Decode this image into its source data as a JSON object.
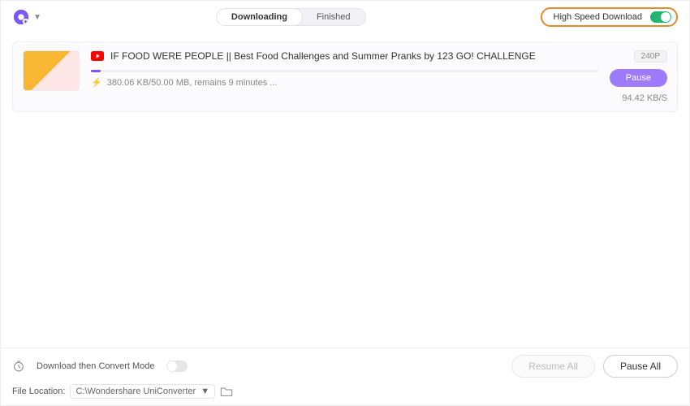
{
  "header": {
    "tab_downloading": "Downloading",
    "tab_finished": "Finished",
    "hsd_label": "High Speed Download"
  },
  "item": {
    "title": "IF FOOD WERE PEOPLE ||  Best Food Challenges and Summer Pranks by 123 GO! CHALLENGE",
    "quality": "240P",
    "progress_text": "380.06 KB/50.00 MB, remains 9 minutes ...",
    "speed": "94.42 KB/S",
    "pause_label": "Pause",
    "progress_percent": 2
  },
  "footer": {
    "convert_label": "Download then Convert Mode",
    "resume_all": "Resume All",
    "pause_all": "Pause All",
    "file_location_label": "File Location:",
    "file_location_value": "C:\\Wondershare UniConverter"
  }
}
